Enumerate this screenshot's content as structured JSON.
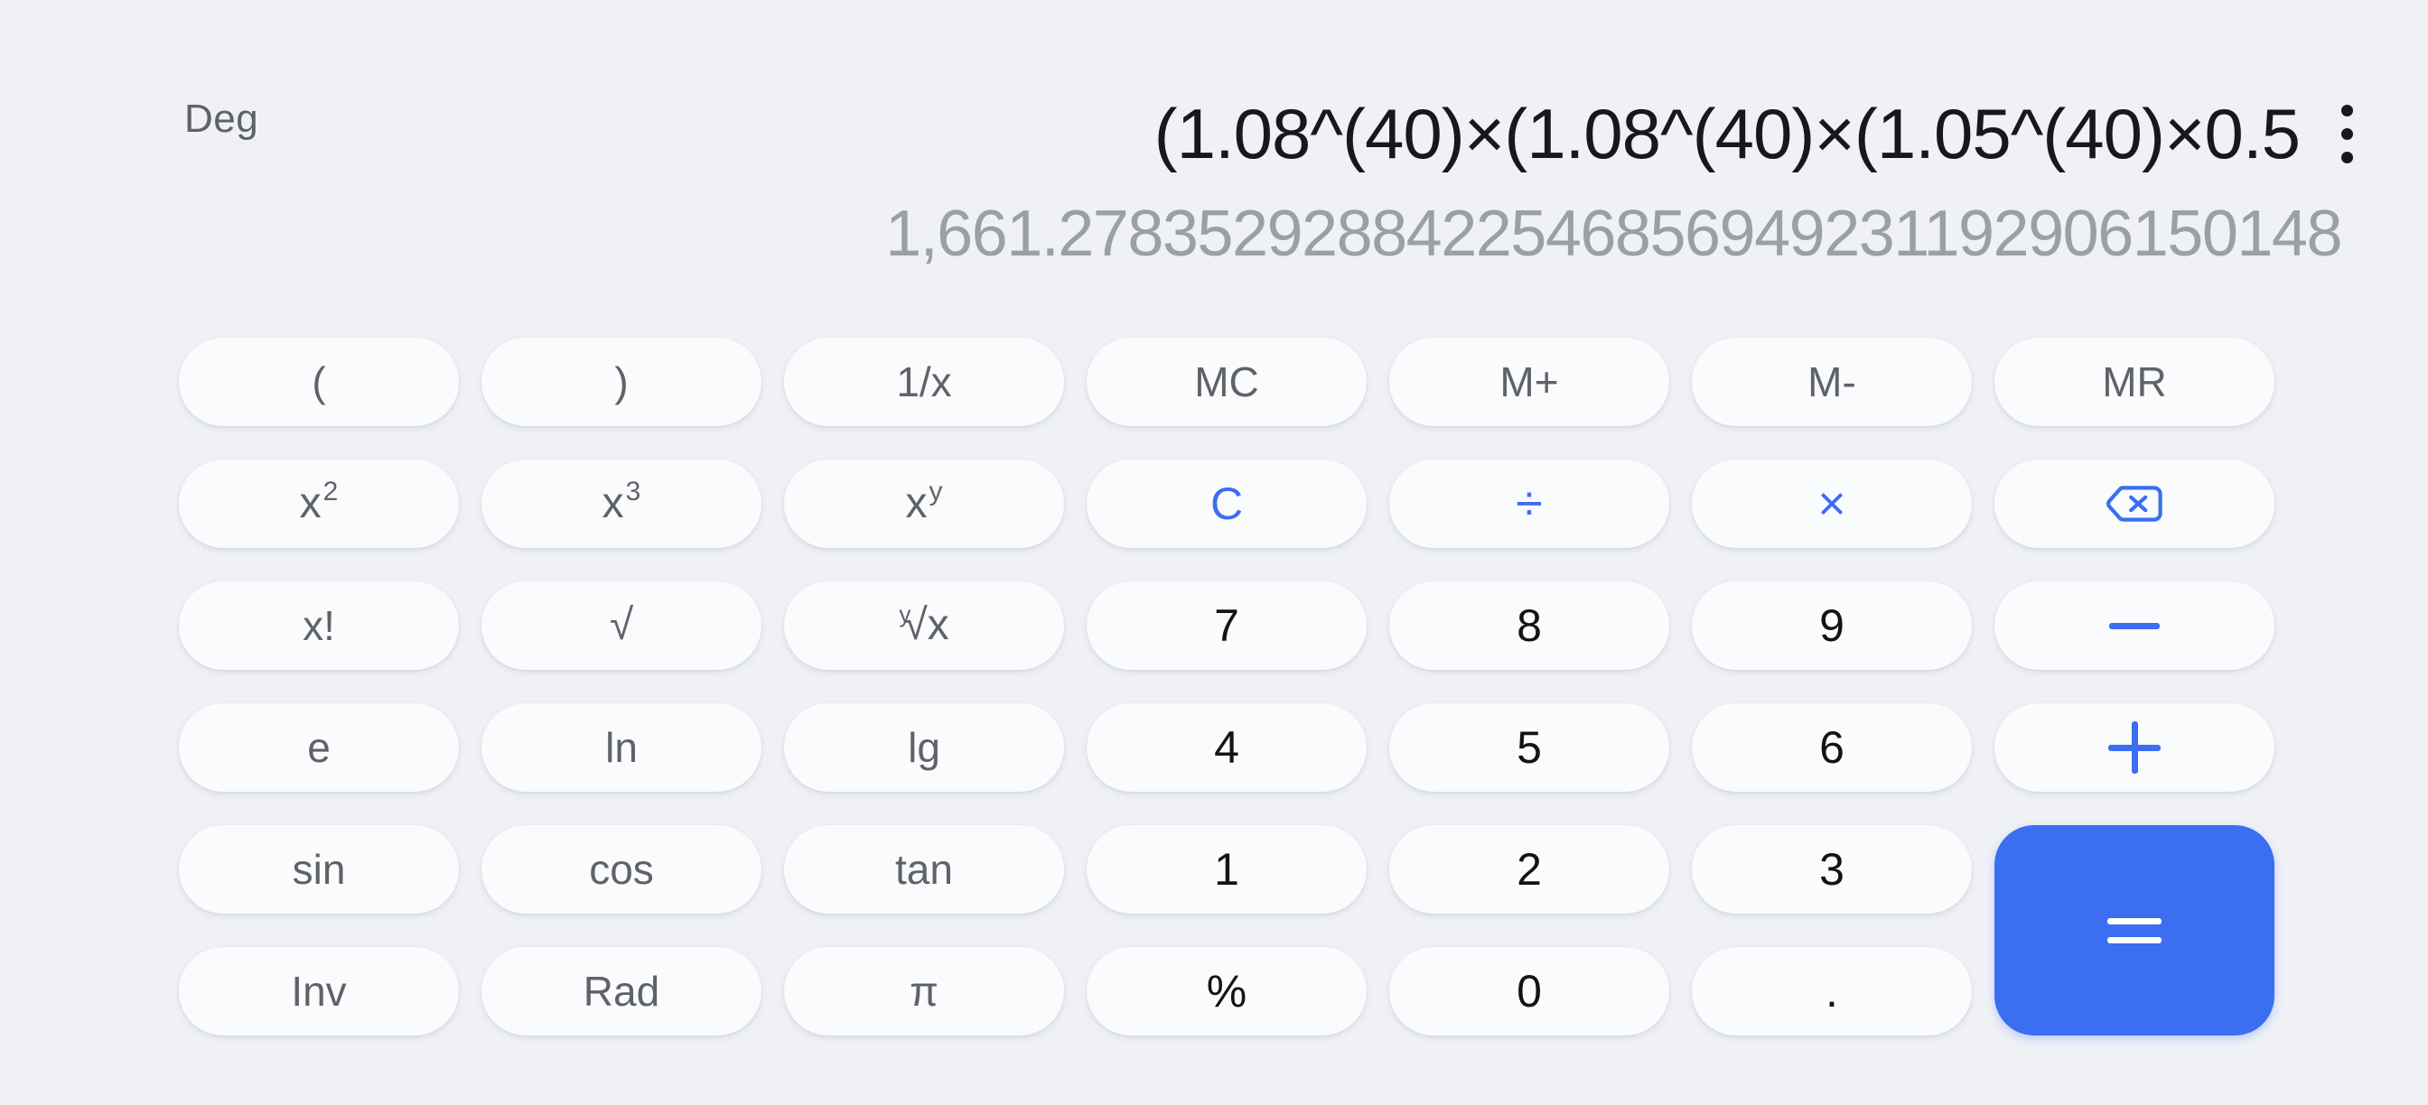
{
  "app": {
    "name": "Calculator",
    "background_color": "#eff1f5",
    "accent_color": "#3b6ef0"
  },
  "display": {
    "angle_mode": "Deg",
    "expression": "(1.08^(40)×(1.08^(40)×(1.05^(40)×0.5",
    "result": "1,661.2783529288422546856949231192906150148",
    "overflow_menu_icon": "more-vertical-icon"
  },
  "keypad": {
    "rows": [
      [
        {
          "id": "open-paren",
          "label": "(",
          "type": "function"
        },
        {
          "id": "close-paren",
          "label": ")",
          "type": "function"
        },
        {
          "id": "reciprocal",
          "label": "1/x",
          "type": "function"
        },
        {
          "id": "memory-clear",
          "label": "MC",
          "type": "function"
        },
        {
          "id": "memory-add",
          "label": "M+",
          "type": "function"
        },
        {
          "id": "memory-sub",
          "label": "M-",
          "type": "function"
        },
        {
          "id": "memory-recall",
          "label": "MR",
          "type": "function"
        }
      ],
      [
        {
          "id": "square",
          "label": "x²",
          "base": "x",
          "exp": "2",
          "type": "function"
        },
        {
          "id": "cube",
          "label": "x³",
          "base": "x",
          "exp": "3",
          "type": "function"
        },
        {
          "id": "power",
          "label": "xʸ",
          "base": "x",
          "exp": "y",
          "type": "function"
        },
        {
          "id": "clear",
          "label": "C",
          "type": "clear"
        },
        {
          "id": "divide",
          "label": "÷",
          "type": "operator"
        },
        {
          "id": "multiply",
          "label": "×",
          "type": "operator"
        },
        {
          "id": "backspace",
          "label": "backspace-icon",
          "type": "operator-icon"
        }
      ],
      [
        {
          "id": "factorial",
          "label": "x!",
          "type": "function"
        },
        {
          "id": "square-root",
          "label": "√",
          "type": "function"
        },
        {
          "id": "nth-root",
          "label": "ʸ√x",
          "idx": "y",
          "rad": "√x",
          "type": "function"
        },
        {
          "id": "digit-7",
          "label": "7",
          "type": "number"
        },
        {
          "id": "digit-8",
          "label": "8",
          "type": "number"
        },
        {
          "id": "digit-9",
          "label": "9",
          "type": "number"
        },
        {
          "id": "subtract",
          "label": "−",
          "type": "operator-minus"
        }
      ],
      [
        {
          "id": "euler",
          "label": "e",
          "type": "function"
        },
        {
          "id": "natural-log",
          "label": "ln",
          "type": "function"
        },
        {
          "id": "log10",
          "label": "lg",
          "type": "function"
        },
        {
          "id": "digit-4",
          "label": "4",
          "type": "number"
        },
        {
          "id": "digit-5",
          "label": "5",
          "type": "number"
        },
        {
          "id": "digit-6",
          "label": "6",
          "type": "number"
        },
        {
          "id": "add",
          "label": "+",
          "type": "operator-plus"
        }
      ],
      [
        {
          "id": "sine",
          "label": "sin",
          "type": "function"
        },
        {
          "id": "cosine",
          "label": "cos",
          "type": "function"
        },
        {
          "id": "tangent",
          "label": "tan",
          "type": "function"
        },
        {
          "id": "digit-1",
          "label": "1",
          "type": "number"
        },
        {
          "id": "digit-2",
          "label": "2",
          "type": "number"
        },
        {
          "id": "digit-3",
          "label": "3",
          "type": "number"
        },
        {
          "id": "equals",
          "label": "=",
          "type": "equals"
        }
      ],
      [
        {
          "id": "inverse",
          "label": "Inv",
          "type": "function"
        },
        {
          "id": "radian-mode",
          "label": "Rad",
          "type": "function"
        },
        {
          "id": "pi",
          "label": "π",
          "type": "function"
        },
        {
          "id": "percent",
          "label": "%",
          "type": "number"
        },
        {
          "id": "digit-0",
          "label": "0",
          "type": "number"
        },
        {
          "id": "decimal-point",
          "label": ".",
          "type": "number"
        }
      ]
    ]
  }
}
